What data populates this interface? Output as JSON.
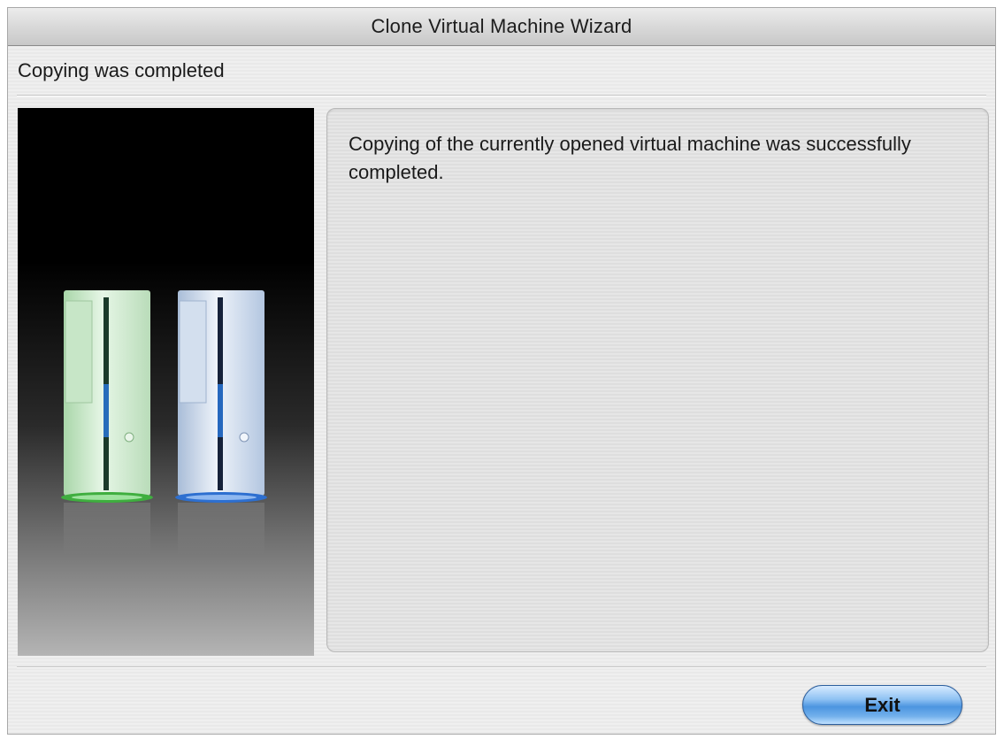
{
  "window": {
    "title": "Clone Virtual Machine Wizard"
  },
  "step": {
    "title": "Copying was completed"
  },
  "content": {
    "message": "Copying of the currently opened virtual machine was successfully completed."
  },
  "image": {
    "description_icon": "two-computer-towers-icon",
    "colors": {
      "green_tower": "#cfe9cf",
      "blue_tower": "#d7e2f1",
      "green_glow": "#3fae3f",
      "blue_glow": "#2d6fd0"
    }
  },
  "buttons": {
    "exit_label": "Exit"
  },
  "colors": {
    "accent": "#4c95e0"
  }
}
